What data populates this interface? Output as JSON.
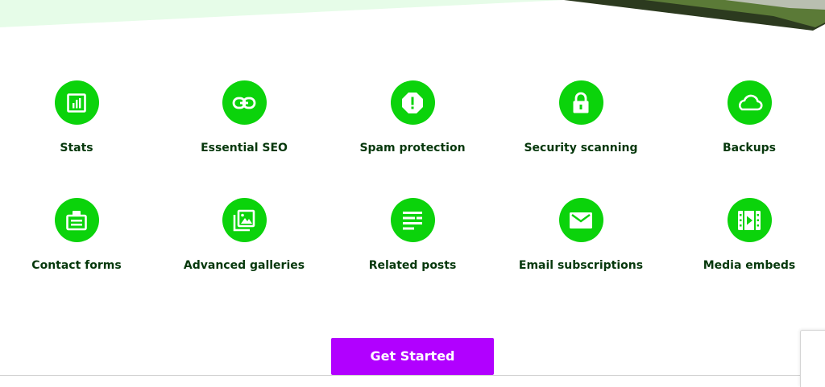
{
  "colors": {
    "accent_green": "#0bd30b",
    "label_text": "#06380c",
    "cta_purple": "#b100ff",
    "mint_band": "#e6fce8"
  },
  "features": [
    {
      "label": "Stats",
      "icon": "bar-chart-icon"
    },
    {
      "label": "Essential SEO",
      "icon": "link-icon"
    },
    {
      "label": "Spam protection",
      "icon": "spam-alert-icon"
    },
    {
      "label": "Security scanning",
      "icon": "lock-icon"
    },
    {
      "label": "Backups",
      "icon": "cloud-icon"
    },
    {
      "label": "Contact forms",
      "icon": "contact-card-icon"
    },
    {
      "label": "Advanced galleries",
      "icon": "gallery-icon"
    },
    {
      "label": "Related posts",
      "icon": "text-lines-icon"
    },
    {
      "label": "Email subscriptions",
      "icon": "envelope-icon"
    },
    {
      "label": "Media embeds",
      "icon": "video-icon"
    }
  ],
  "cta": {
    "label": "Get Started"
  }
}
